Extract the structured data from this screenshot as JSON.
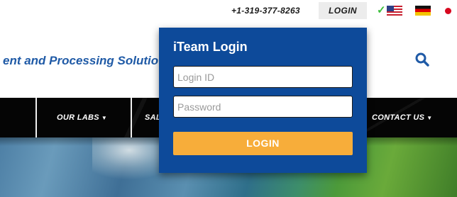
{
  "topbar": {
    "phone": "+1-319-377-8263",
    "login_label": "LOGIN",
    "check_icon": "check-icon",
    "flags": [
      "us-flag-icon",
      "germany-flag-icon",
      "japan-flag-icon"
    ]
  },
  "header": {
    "tagline": "ent and Processing Solutio",
    "search_icon": "search-icon"
  },
  "nav": {
    "items": [
      {
        "label": "OUR LABS"
      },
      {
        "label": "SAL"
      },
      {
        "label": "CONTACT US"
      }
    ]
  },
  "login_popup": {
    "title": "iTeam Login",
    "login_id_placeholder": "Login ID",
    "password_placeholder": "Password",
    "button_label": "LOGIN"
  },
  "colors": {
    "popup_bg": "#0d4a9a",
    "login_button": "#f7ad3a",
    "tagline": "#1f5aa6",
    "nav_bg": "#050505",
    "check": "#3cbf3c"
  }
}
